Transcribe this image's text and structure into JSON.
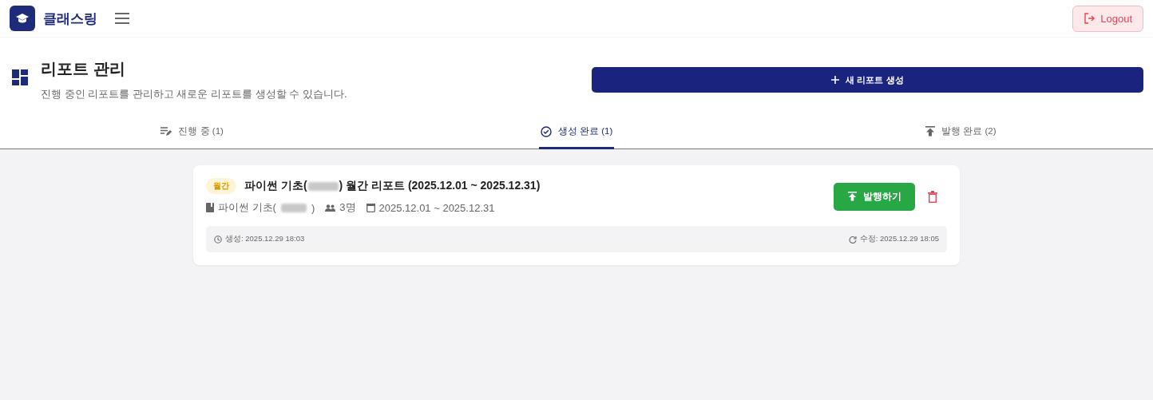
{
  "app": {
    "name": "클래스링"
  },
  "logout": {
    "label": "Logout"
  },
  "page": {
    "title": "리포트 관리",
    "subtitle": "진행 중인 리포트를 관리하고 새로운 리포트를 생성할 수 있습니다."
  },
  "create_button": {
    "label": "새 리포트 생성"
  },
  "tabs": [
    {
      "label": "진행 중 (1)",
      "kind": "progress",
      "selected": false
    },
    {
      "label": "생성 완료 (1)",
      "kind": "done",
      "selected": true
    },
    {
      "label": "발행 완료 (2)",
      "kind": "published",
      "selected": false
    }
  ],
  "reports": [
    {
      "badge": "월간",
      "title_start": "파이썬 기초(",
      "title_end": ") 월간 리포트 (2025.12.01 ~ 2025.12.31)",
      "course_start": "파이썬 기초(",
      "course_end": ")",
      "students": "3명",
      "period": "2025.12.01 ~ 2025.12.31",
      "publish_label": "발행하기",
      "created": "생성: 2025.12.29 18:03",
      "modified": "수정: 2025.12.29 18:05"
    }
  ]
}
